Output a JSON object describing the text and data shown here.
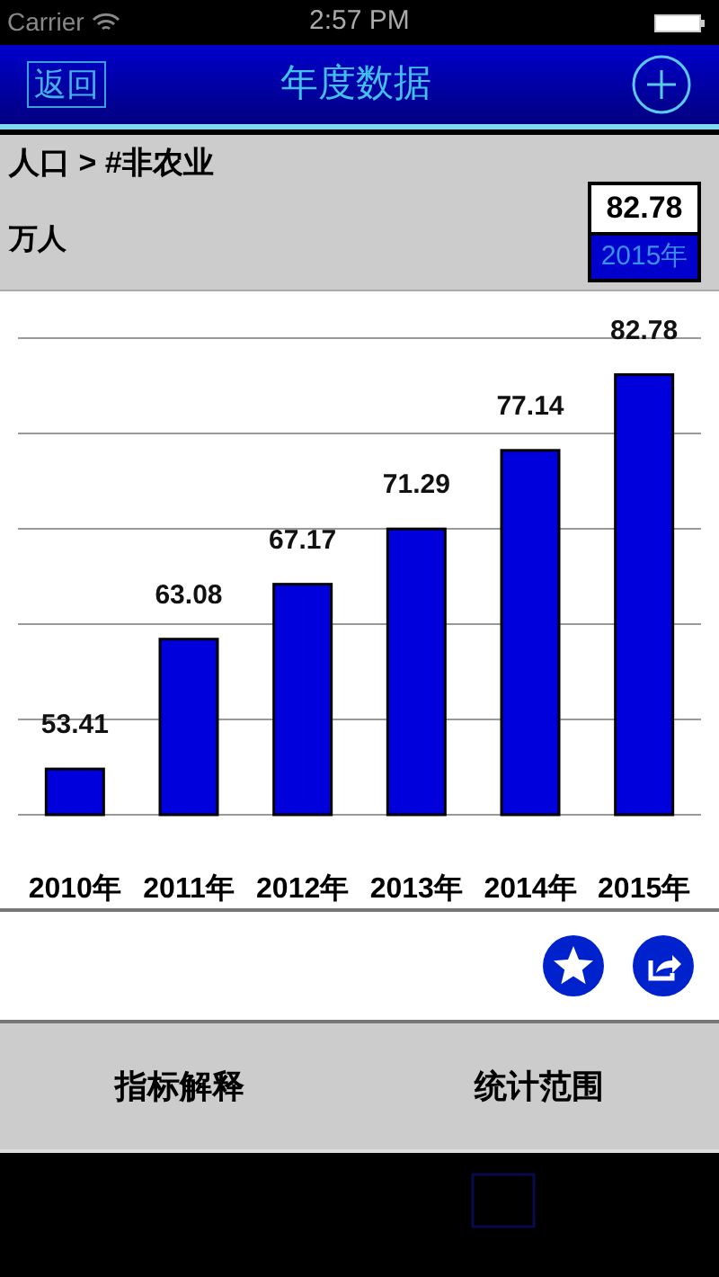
{
  "status_bar": {
    "carrier": "Carrier",
    "time": "2:57 PM"
  },
  "nav": {
    "back": "返回",
    "title": "年度数据"
  },
  "breadcrumb": "人口 > #非农业",
  "unit": "万人",
  "tooltip": {
    "value": "82.78",
    "label": "2015年"
  },
  "chart_data": {
    "type": "bar",
    "categories": [
      "2010年",
      "2011年",
      "2012年",
      "2013年",
      "2014年",
      "2015年"
    ],
    "values": [
      53.41,
      63.08,
      67.17,
      71.29,
      77.14,
      82.78
    ],
    "ylim": [
      50,
      85.5
    ],
    "data_labels": true
  },
  "bottom_tabs": [
    "指标解释",
    "统计范围"
  ]
}
